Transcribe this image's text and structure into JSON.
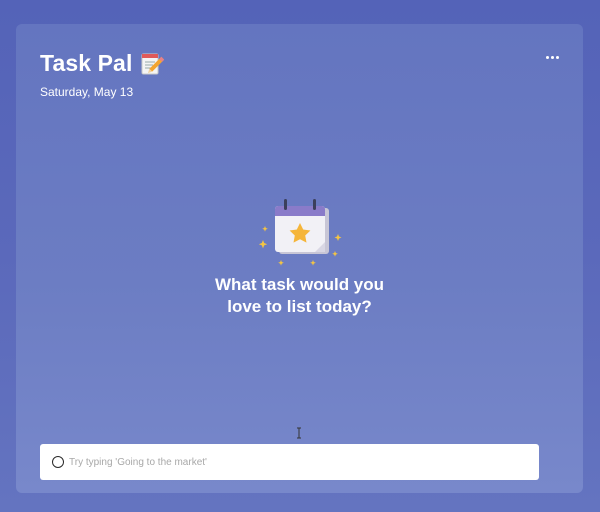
{
  "header": {
    "title": "Task Pal",
    "title_icon": "memo-pencil-icon",
    "date": "Saturday, May 13",
    "menu_icon": "more-horizontal-icon"
  },
  "empty_state": {
    "illustration": "calendar-star-icon",
    "line1": "What task would you",
    "line2": "love to list today?"
  },
  "task_input": {
    "placeholder": "Try typing 'Going to the market'",
    "value": ""
  },
  "colors": {
    "background": "#5b69bb",
    "card": "#6c7dc3",
    "calendar_header": "#8a7bc9",
    "star": "#f5b53a"
  }
}
